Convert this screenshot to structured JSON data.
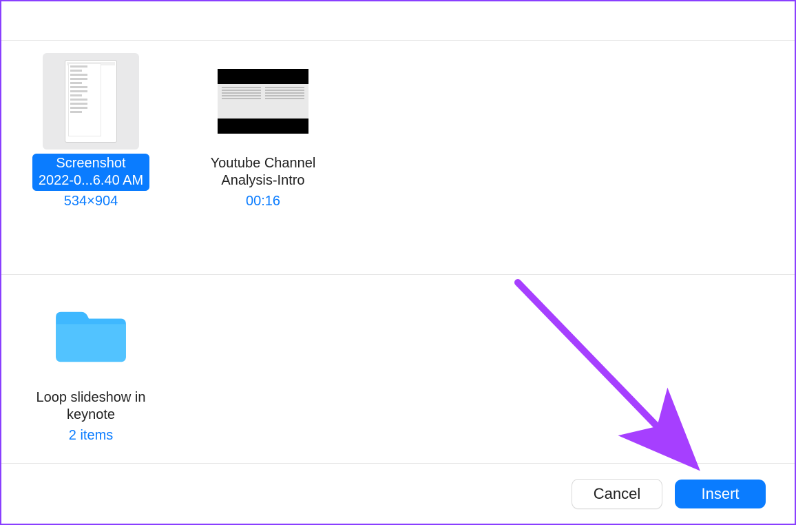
{
  "files": [
    {
      "name_line1": "Screenshot",
      "name_line2": "2022-0...6.40 AM",
      "meta": "534×904",
      "selected": true,
      "kind": "image"
    },
    {
      "name_line1": "Youtube Channel",
      "name_line2": "Analysis-Intro",
      "meta": "00:16",
      "selected": false,
      "kind": "video"
    }
  ],
  "folders": [
    {
      "name_line1": "Loop slideshow in",
      "name_line2": "keynote",
      "meta": "2 items"
    }
  ],
  "footer": {
    "cancel_label": "Cancel",
    "insert_label": "Insert"
  }
}
